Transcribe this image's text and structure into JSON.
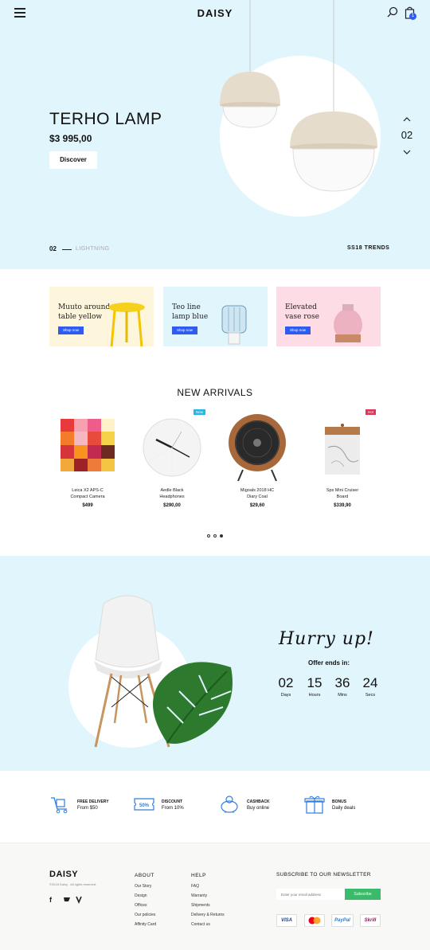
{
  "header": {
    "logo": "DAISY",
    "cart_count": "1"
  },
  "hero": {
    "title": "TERHO LAMP",
    "price": "$3 995,00",
    "cta": "Discover",
    "slide_number": "02",
    "slide_index": "02",
    "category": "LIGHTNING",
    "trends": "SS18 TRENDS"
  },
  "promos": [
    {
      "line1": "Muuto around",
      "line2": "table yellow",
      "button": "Shop now",
      "bg": "#fdf6dc"
    },
    {
      "line1": "Teo line",
      "line2": "lamp blue",
      "button": "Shop now",
      "bg": "#e1f5fd"
    },
    {
      "line1": "Elevated",
      "line2": "vase rose",
      "button": "Shop now",
      "bg": "#fddce5"
    }
  ],
  "new_arrivals": {
    "title": "NEW ARRIVALS",
    "products": [
      {
        "name1": "Leica X2 APS-C",
        "name2": "Compact Camera",
        "price": "$499",
        "tag": ""
      },
      {
        "name1": "Aedle Black",
        "name2": "Headphones",
        "price": "$290,00",
        "tag": "New"
      },
      {
        "name1": "Migoals 2018 HC",
        "name2": "Diary Coal",
        "price": "$29,60",
        "tag": ""
      },
      {
        "name1": "Sps Mini Cruiser",
        "name2": "Board",
        "price": "$339,90",
        "tag": "Hot"
      }
    ]
  },
  "countdown": {
    "headline": "Hurry up!",
    "subtitle": "Offer ends in:",
    "units": [
      {
        "value": "02",
        "label": "Days"
      },
      {
        "value": "15",
        "label": "Hours"
      },
      {
        "value": "36",
        "label": "Mins"
      },
      {
        "value": "24",
        "label": "Secs"
      }
    ]
  },
  "features": [
    {
      "title": "FREE DELIVERY",
      "sub": "From $50",
      "icon": "delivery-cart-icon"
    },
    {
      "title": "DISCOUNT",
      "sub": "From 10%",
      "icon": "discount-ticket-icon",
      "badge": "50%"
    },
    {
      "title": "CASHBACK",
      "sub": "Buy online",
      "icon": "piggy-bank-icon"
    },
    {
      "title": "BONUS",
      "sub": "Daily deals",
      "icon": "gift-box-icon"
    }
  ],
  "footer": {
    "logo": "DAISY",
    "copyright": "©2018 Daisy . All rights reserved.",
    "about": {
      "title": "ABOUT",
      "links": [
        "Our Story",
        "Design",
        "Offices",
        "Our policies",
        "Affinity Card"
      ]
    },
    "help": {
      "title": "HELP",
      "links": [
        "FAQ",
        "Warranty",
        "Shipments",
        "Delivery & Returns",
        "Contact us"
      ]
    },
    "newsletter": {
      "title": "SUBSCRIBE TO OUR NEWSLETTER",
      "placeholder": "Enter your email address",
      "button": "Subscribe"
    },
    "payments": [
      "VISA",
      "",
      "PayPal",
      "Skrill"
    ]
  },
  "colors": {
    "accent": "#2f5cf0",
    "hero_bg": "#e1f5fd",
    "subscribe": "#3bba6a"
  }
}
